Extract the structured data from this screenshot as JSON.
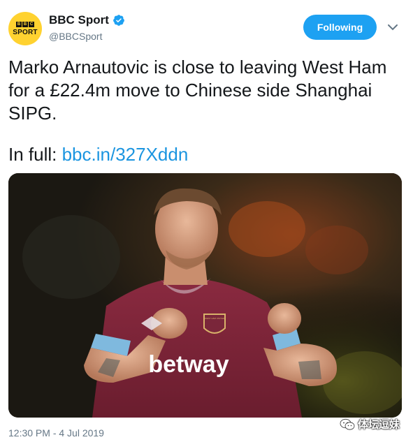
{
  "account": {
    "display_name": "BBC Sport",
    "handle": "@BBCSport",
    "avatar_letters": [
      "B",
      "B",
      "C"
    ],
    "avatar_word": "SPORT",
    "verified": true
  },
  "follow_button": {
    "label": "Following"
  },
  "tweet": {
    "text": "Marko Arnautovic is close to leaving West Ham for a £22.4m move to Chinese side Shanghai SIPG.",
    "link_prefix": "In full: ",
    "link_text": "bbc.in/327Xddn"
  },
  "media": {
    "jersey_sponsor": "betway",
    "crest_text": "WEST HAM UNITED"
  },
  "footer": {
    "timestamp": "12:30 PM - 4 Jul 2019",
    "watermark": "体坛逗妹"
  },
  "colors": {
    "accent": "#1da1f2",
    "link": "#1b95e0",
    "muted": "#657786",
    "avatar_bg": "#ffd230",
    "claret": "#7a263a"
  }
}
